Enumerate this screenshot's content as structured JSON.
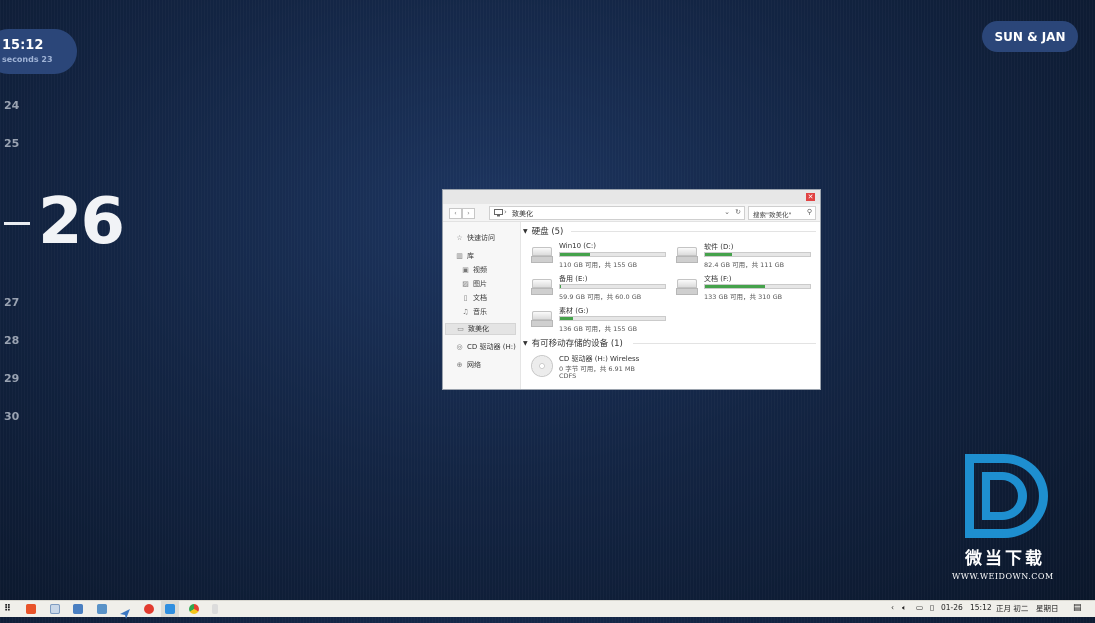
{
  "widget": {
    "time": "15:12",
    "seconds": "seconds 23",
    "date_label": "SUN & JAN",
    "days_before": [
      "24",
      "25"
    ],
    "today": "26",
    "days_after": [
      "27",
      "28",
      "29",
      "30"
    ]
  },
  "explorer": {
    "address_path": "致美化",
    "search_placeholder": "搜索\"致美化\"",
    "sidebar": [
      {
        "label": "快速访问",
        "icon": "star-icon"
      },
      {
        "label": "库",
        "icon": "library-icon"
      },
      {
        "label": "视频",
        "icon": "video-icon"
      },
      {
        "label": "图片",
        "icon": "picture-icon"
      },
      {
        "label": "文档",
        "icon": "document-icon"
      },
      {
        "label": "音乐",
        "icon": "music-icon"
      },
      {
        "label": "致美化",
        "icon": "computer-icon"
      },
      {
        "label": "CD 驱动器 (H:)",
        "icon": "cd-icon"
      },
      {
        "label": "网络",
        "icon": "network-icon"
      }
    ],
    "group_drives": "硬盘 (5)",
    "group_removable": "有可移动存储的设备 (1)",
    "drives": [
      {
        "name": "Win10 (C:)",
        "info": "110 GB 可用，共 155 GB",
        "used": 0.29
      },
      {
        "name": "软件 (D:)",
        "info": "82.4 GB 可用，共 111 GB",
        "used": 0.26
      },
      {
        "name": "备用 (E:)",
        "info": "59.9 GB 可用，共 60.0 GB",
        "used": 0.01
      },
      {
        "name": "文档 (F:)",
        "info": "133 GB 可用，共 310 GB",
        "used": 0.57
      },
      {
        "name": "素材 (G:)",
        "info": "136 GB 可用，共 155 GB",
        "used": 0.12
      }
    ],
    "cd": {
      "name": "CD 驱动器 (H:) Wireless",
      "info": "0 字节 可用，共 6.91 MB",
      "fs": "CDFS"
    }
  },
  "logo": {
    "text": "微当下载",
    "url": "WWW.WEIDOWN.COM"
  },
  "taskbar": {
    "tray_date": "01-26",
    "tray_time": "15:12",
    "tray_lunar": "正月 初二",
    "tray_weekday": "星期日"
  },
  "colors": {
    "accent_pill": "#2b4679",
    "drive_bar": "#45a24b",
    "logo_blue": "#1e8fd0"
  }
}
